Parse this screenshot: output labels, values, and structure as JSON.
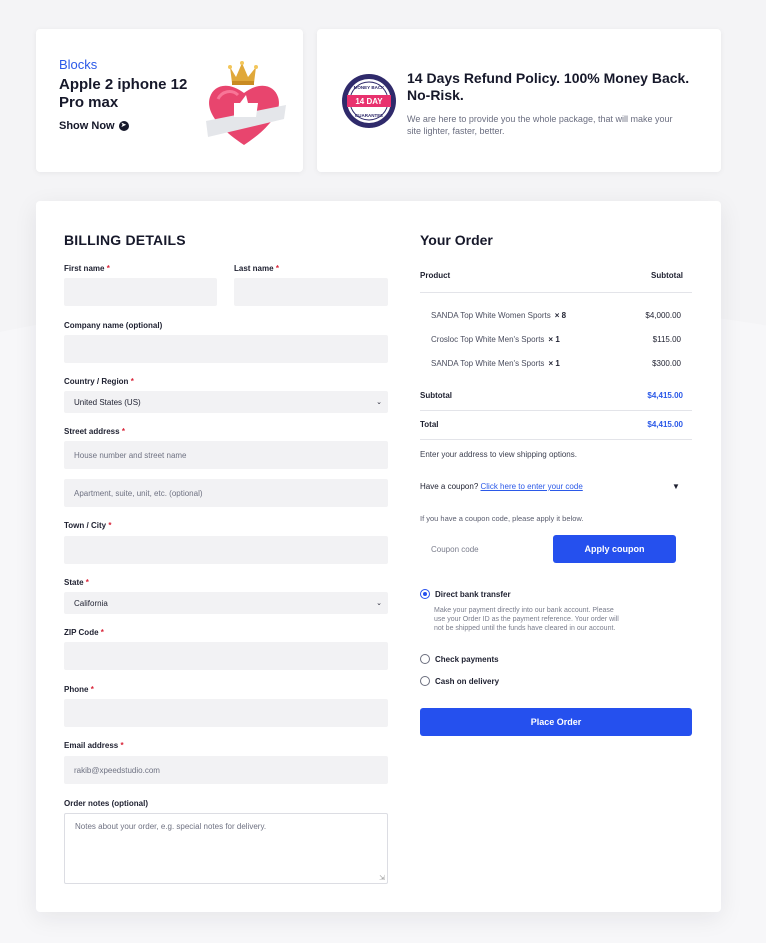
{
  "promo_product": {
    "tag": "Blocks",
    "title": "Apple 2 iphone 12 Pro max",
    "cta": "Show Now"
  },
  "promo_refund": {
    "badge_top": "MONEY BACK",
    "badge_mid": "14 DAY",
    "badge_bottom": "GUARANTEE",
    "headline": "14 Days Refund Policy. 100% Money Back. No-Risk.",
    "description": "We are here to provide you the whole package, that will make your site lighter, faster, better."
  },
  "billing": {
    "title": "BILLING DETAILS",
    "first_name_label": "First name",
    "last_name_label": "Last name",
    "company_label": "Company name (optional)",
    "country_label": "Country / Region",
    "country_value": "United States (US)",
    "street_label": "Street address",
    "street_placeholder": "House number and street name",
    "apt_placeholder": "Apartment, suite, unit, etc. (optional)",
    "town_label": "Town / City",
    "state_label": "State",
    "state_value": "California",
    "zip_label": "ZIP Code",
    "phone_label": "Phone",
    "email_label": "Email address",
    "email_value": "rakib@xpeedstudio.com",
    "notes_label": "Order notes (optional)",
    "notes_placeholder": "Notes about your order, e.g. special notes for delivery.",
    "required_mark": "*"
  },
  "order": {
    "title": "Your Order",
    "col_product": "Product",
    "col_subtotal": "Subtotal",
    "items": [
      {
        "name": "SANDA Top White Women Sports",
        "qty": "× 8",
        "price": "$4,000.00"
      },
      {
        "name": "Crosloc Top White Men's Sports",
        "qty": "× 1",
        "price": "$115.00"
      },
      {
        "name": "SANDA Top White Men's Sports",
        "qty": "× 1",
        "price": "$300.00"
      }
    ],
    "subtotal_label": "Subtotal",
    "subtotal_value": "$4,415.00",
    "total_label": "Total",
    "total_value": "$4,415.00",
    "shipping_note": "Enter your address to view shipping options.",
    "coupon_question": "Have a coupon?",
    "coupon_link": "Click here to enter your code",
    "coupon_note": "If you have a coupon code, please apply it below.",
    "coupon_placeholder": "Coupon code",
    "apply_coupon": "Apply coupon",
    "payment_methods": [
      {
        "label": "Direct bank transfer",
        "selected": true
      },
      {
        "label": "Check payments",
        "selected": false
      },
      {
        "label": "Cash on delivery",
        "selected": false
      }
    ],
    "bank_note": "Make your payment directly into our bank account. Please use your Order ID as the payment reference. Your order will not be shipped until the funds have cleared in our account.",
    "place_order": "Place Order"
  },
  "colors": {
    "accent": "#2550ee",
    "link": "#2b59e8",
    "required": "#d9263a",
    "field_bg": "#f2f2f4"
  }
}
